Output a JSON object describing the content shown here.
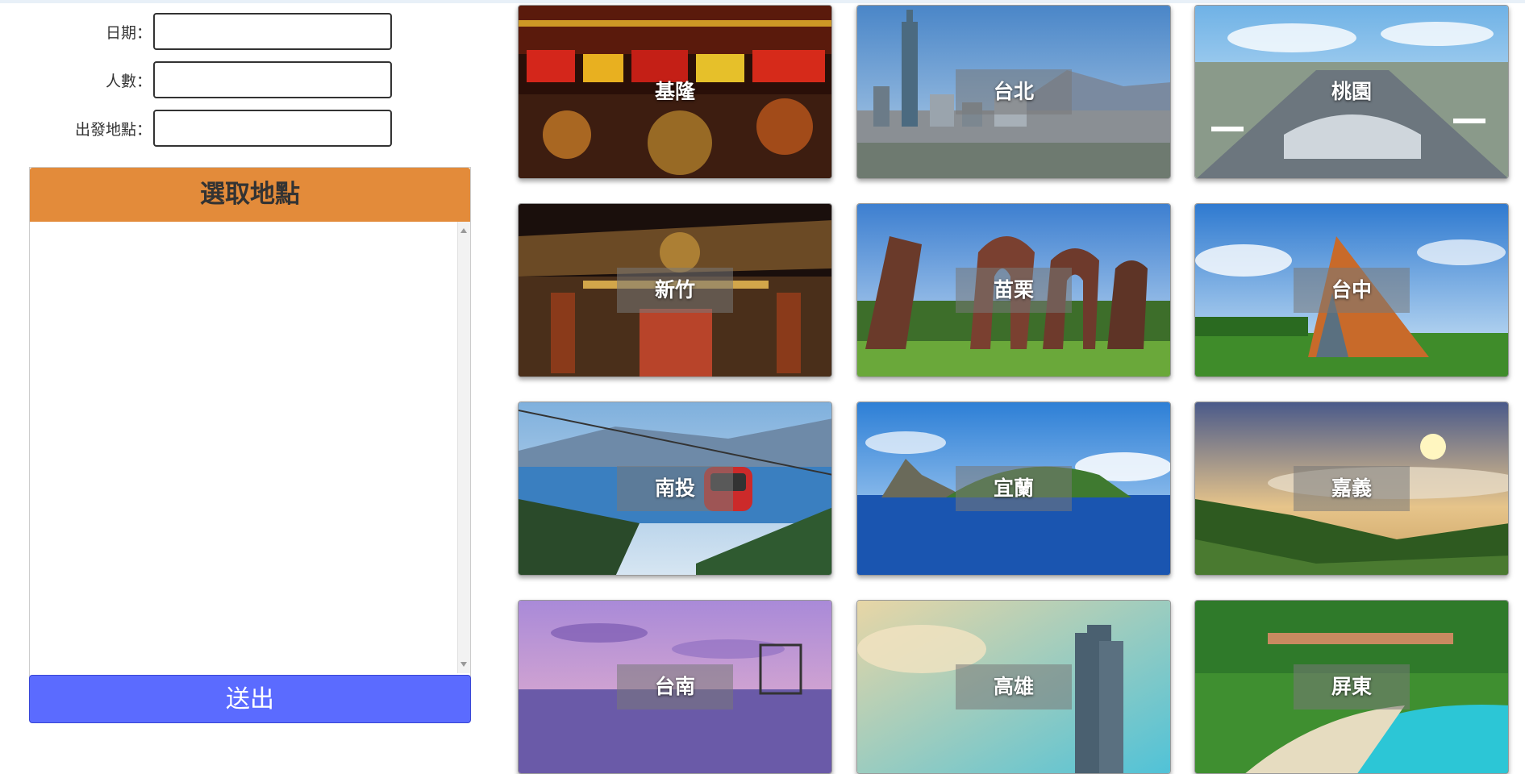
{
  "form": {
    "date_label": "日期：",
    "people_label": "人數：",
    "origin_label": "出發地點：",
    "date_value": "",
    "people_value": "",
    "origin_value": ""
  },
  "picker": {
    "header": "選取地點"
  },
  "submit_label": "送出",
  "colors": {
    "picker_header": "#e38b3a",
    "submit": "#5b6bff"
  },
  "cities": [
    {
      "name": "基隆"
    },
    {
      "name": "台北"
    },
    {
      "name": "桃園"
    },
    {
      "name": "新竹"
    },
    {
      "name": "苗栗"
    },
    {
      "name": "台中"
    },
    {
      "name": "南投"
    },
    {
      "name": "宜蘭"
    },
    {
      "name": "嘉義"
    },
    {
      "name": "台南"
    },
    {
      "name": "高雄"
    },
    {
      "name": "屏東"
    }
  ]
}
